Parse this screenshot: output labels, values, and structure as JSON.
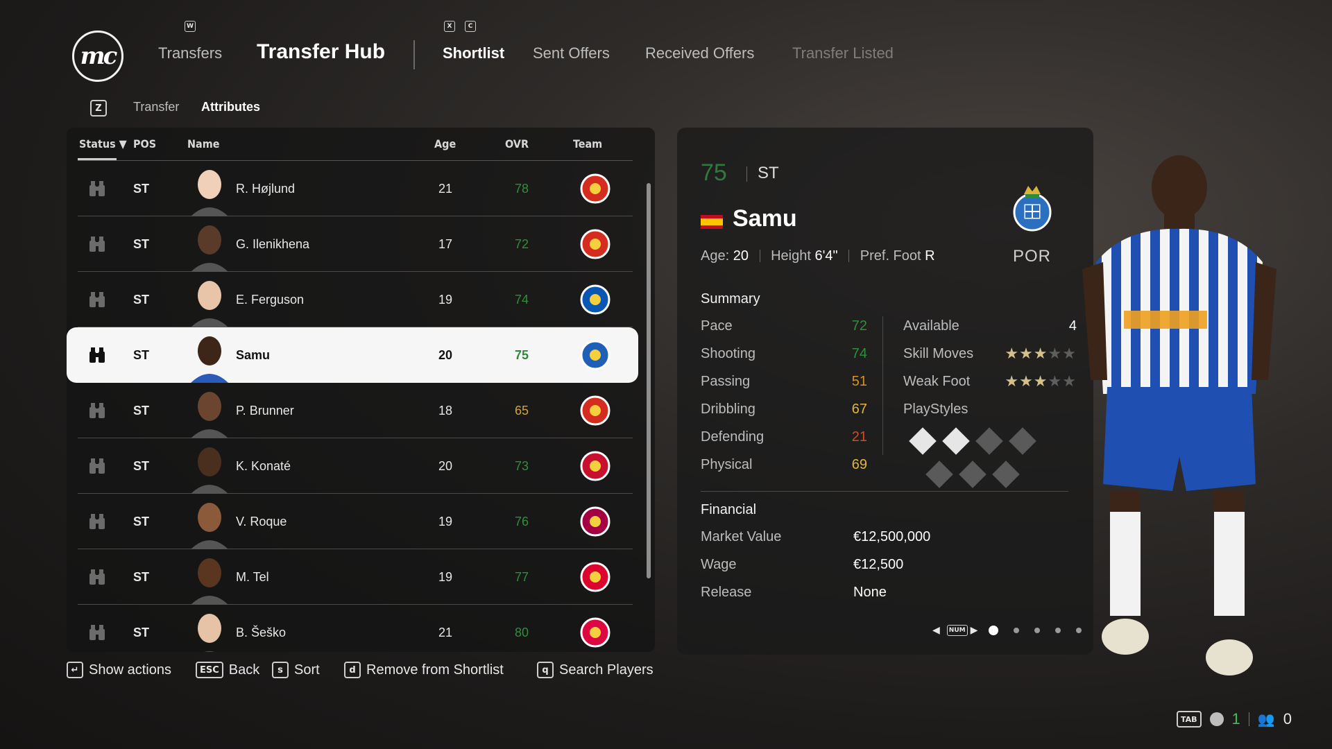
{
  "header": {
    "logo_text": "mc",
    "nav": {
      "transfers": "Transfers",
      "transfer_hub": "Transfer Hub",
      "shortlist": "Shortlist",
      "sent_offers": "Sent Offers",
      "received_offers": "Received Offers",
      "transfer_listed": "Transfer Listed"
    },
    "hint_keys": {
      "w": "W",
      "x": "X",
      "c": "C"
    }
  },
  "subtabs": {
    "key": "Z",
    "transfer": "Transfer",
    "attributes": "Attributes"
  },
  "table": {
    "columns": {
      "status": "Status ▼",
      "pos": "POS",
      "name": "Name",
      "age": "Age",
      "ovr": "OVR",
      "team": "Team"
    },
    "rows": [
      {
        "pos": "ST",
        "name": "R. Højlund",
        "age": "21",
        "ovr": "78",
        "ovr_color": "#2f8f3c",
        "team_icon": "man-utd-crest"
      },
      {
        "pos": "ST",
        "name": "G. Ilenikhena",
        "age": "17",
        "ovr": "72",
        "ovr_color": "#2f8f3c",
        "team_icon": "monaco-crest"
      },
      {
        "pos": "ST",
        "name": "E. Ferguson",
        "age": "19",
        "ovr": "74",
        "ovr_color": "#2f8f3c",
        "team_icon": "brighton-crest"
      },
      {
        "pos": "ST",
        "name": "Samu",
        "age": "20",
        "ovr": "75",
        "ovr_color": "#2b8a39",
        "team_icon": "porto-crest"
      },
      {
        "pos": "ST",
        "name": "P. Brunner",
        "age": "18",
        "ovr": "65",
        "ovr_color": "#d2a43a",
        "team_icon": "monaco-crest"
      },
      {
        "pos": "ST",
        "name": "K. Konaté",
        "age": "20",
        "ovr": "73",
        "ovr_color": "#2f8f3c",
        "team_icon": "salzburg-crest"
      },
      {
        "pos": "ST",
        "name": "V. Roque",
        "age": "19",
        "ovr": "76",
        "ovr_color": "#2f8f3c",
        "team_icon": "barcelona-crest"
      },
      {
        "pos": "ST",
        "name": "M. Tel",
        "age": "19",
        "ovr": "77",
        "ovr_color": "#2f8f3c",
        "team_icon": "bayern-crest"
      },
      {
        "pos": "ST",
        "name": "B. Šeško",
        "age": "21",
        "ovr": "80",
        "ovr_color": "#2f8f3c",
        "team_icon": "leipzig-crest"
      }
    ],
    "selected_index": 3
  },
  "detail": {
    "ovr": "75",
    "position": "ST",
    "name": "Samu",
    "age_label": "Age:",
    "age": "20",
    "height_label": "Height",
    "height": "6'4\"",
    "foot_label": "Pref. Foot",
    "foot": "R",
    "club": "POR",
    "summary_title": "Summary",
    "attributes": [
      {
        "label": "Pace",
        "value": "72",
        "color": "#2f8f3c"
      },
      {
        "label": "Shooting",
        "value": "74",
        "color": "#2f8f3c"
      },
      {
        "label": "Passing",
        "value": "51",
        "color": "#d6912a"
      },
      {
        "label": "Dribbling",
        "value": "67",
        "color": "#e3b53d"
      },
      {
        "label": "Defending",
        "value": "21",
        "color": "#d24a2a"
      },
      {
        "label": "Physical",
        "value": "69",
        "color": "#e3b53d"
      }
    ],
    "available_label": "Available",
    "available_value": "4",
    "skill_moves_label": "Skill Moves",
    "skill_moves_stars": 3,
    "weak_foot_label": "Weak Foot",
    "weak_foot_stars": 3,
    "playstyles_label": "PlayStyles",
    "financial_title": "Financial",
    "financial": [
      {
        "label": "Market Value",
        "value": "€12,500,000"
      },
      {
        "label": "Wage",
        "value": "€12,500"
      },
      {
        "label": "Release",
        "value": "None"
      }
    ],
    "pager_key": "NUM",
    "page_count": 5,
    "page_active": 1
  },
  "footer": {
    "show_actions": "Show actions",
    "back_key": "ESC",
    "back": "Back",
    "sort_key": "s",
    "sort": "Sort",
    "remove_key": "d",
    "remove": "Remove from Shortlist",
    "search_key": "q",
    "search": "Search Players"
  },
  "status_bar": {
    "tab_key": "TAB",
    "count_a": "1",
    "count_b": "0"
  },
  "colors": {
    "accent_green": "#2f8f3c",
    "selected_row_bg": "#f6f6f6"
  }
}
